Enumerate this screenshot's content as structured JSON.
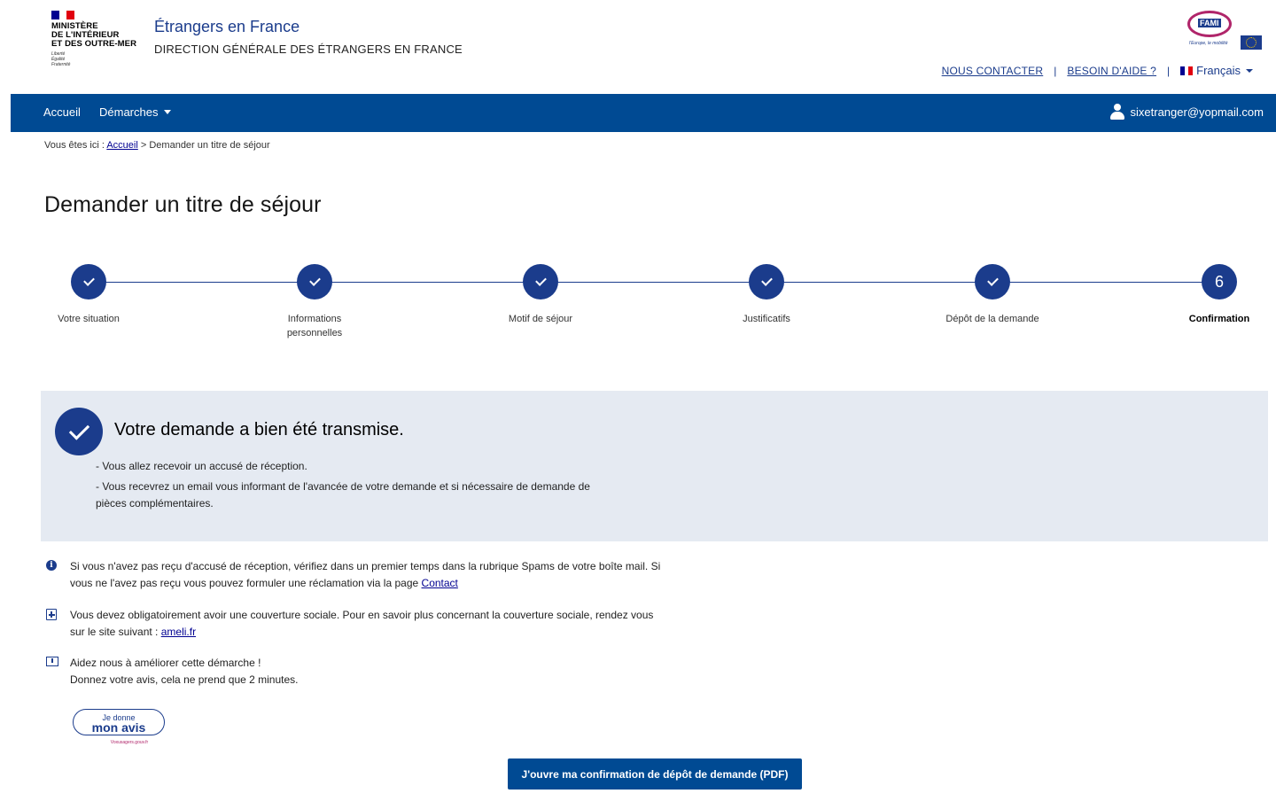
{
  "header": {
    "gov_lines": [
      "MINISTÈRE",
      "DE L'INTÉRIEUR",
      "ET DES OUTRE-MER"
    ],
    "devise": [
      "Liberté",
      "Égalité",
      "Fraternité"
    ],
    "site_title": "Étrangers en France",
    "site_subtitle": "DIRECTION GÉNÉRALE DES ÉTRANGERS EN FRANCE",
    "fami": {
      "label": "FAMI",
      "tagline": "l'Europe, le mobilité"
    },
    "links": {
      "contact": "NOUS CONTACTER",
      "help": "BESOIN D'AIDE ?",
      "separator": "|"
    },
    "language": "Français",
    "flag_colors": [
      "#000091",
      "#ffffff",
      "#e1000f"
    ]
  },
  "nav": {
    "home": "Accueil",
    "demarches": "Démarches",
    "user_email": "sixetranger@yopmail.com",
    "bg_color": "#004a93"
  },
  "breadcrumb": {
    "prefix": "Vous êtes ici :",
    "home": "Accueil",
    "separator": ">",
    "current": "Demander un titre de séjour"
  },
  "page_title": "Demander un titre de séjour",
  "stepper": {
    "steps": [
      {
        "label": "Votre situation",
        "done": true
      },
      {
        "label": "Informations personnelles",
        "done": true
      },
      {
        "label": "Motif de séjour",
        "done": true
      },
      {
        "label": "Justificatifs",
        "done": true
      },
      {
        "label": "Dépôt de la demande",
        "done": true
      },
      {
        "label": "Confirmation",
        "number": "6",
        "active": true
      }
    ]
  },
  "success": {
    "title": "Votre demande a bien été transmise.",
    "lines": [
      "- Vous allez recevoir un accusé de réception.",
      "- Vous recevrez un email vous informant de l'avancée de votre demande et si nécessaire de demande de pièces complémentaires."
    ]
  },
  "info": {
    "spam_text": "Si vous n'avez pas reçu d'accusé de réception, vérifiez dans un premier temps dans la rubrique Spams de votre boîte mail. Si vous ne l'avez pas reçu vous pouvez formuler une réclamation via la page",
    "contact_link": "Contact",
    "social_text": "Vous devez obligatoirement avoir une couverture sociale. Pour en savoir plus concernant la couverture sociale, rendez vous sur le site suivant :",
    "ameli_link": "ameli.fr",
    "feedback_line1": "Aidez nous à améliorer cette démarche !",
    "feedback_line2": "Donnez votre avis, cela ne prend que 2 minutes."
  },
  "avis_badge": {
    "top": "Je donne",
    "main": "mon avis",
    "sub": "Voxusagers.gouv.fr"
  },
  "pdf_button": "J'ouvre ma confirmation de dépôt de demande (PDF)"
}
